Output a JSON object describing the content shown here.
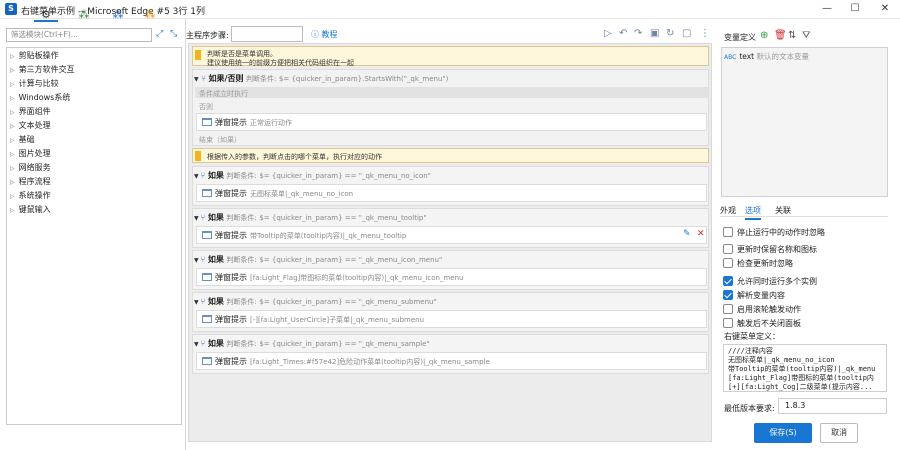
{
  "window": {
    "title": "右键菜单示例 -- Microsoft Edge #5 3行 1列",
    "minimize_icon": "minimize-icon",
    "maximize_icon": "maximize-icon",
    "close_icon": "close-icon"
  },
  "left": {
    "search_placeholder": "筛选模块(Ctrl+F)...",
    "tree": [
      "剪贴板操作",
      "第三方软件交互",
      "计算与比较",
      "Windows系统",
      "界面组件",
      "文本处理",
      "基础",
      "图片处理",
      "网络服务",
      "程序流程",
      "系统操作",
      "键鼠输入"
    ]
  },
  "middle": {
    "step_label": "主程序步骤:",
    "step_value": "",
    "tutorial": "教程",
    "notes": [
      {
        "line1": "判断是否是菜单调用。",
        "line2": "建议使用统一的前缀方便把相关代码组织在一起"
      },
      {
        "line1": "根据传入的参数，判断点击的哪个菜单，执行对应的动作"
      }
    ],
    "first_if": {
      "label": "如果/否则",
      "cond_prefix": "判断条件:",
      "cond": "$= {quicker_in_param}.StartsWith(\"_qk_menu\")",
      "then_label": "条件成立时执行",
      "else_label": "否则",
      "popup_label": "弹窗提示",
      "popup_arg": "正常运行动作",
      "end_label": "结束（如果）"
    },
    "ifs": [
      {
        "label": "如果",
        "cond_prefix": "判断条件:",
        "cond": "$= {quicker_in_param} == \"_qk_menu_no_icon\"",
        "popup_label": "弹窗提示",
        "popup_arg": "无图标菜单|_qk_menu_no_icon"
      },
      {
        "label": "如果",
        "cond_prefix": "判断条件:",
        "cond": "$= {quicker_in_param} == \"_qk_menu_tooltip\"",
        "popup_label": "弹窗提示",
        "popup_arg": "带Tooltip的菜单(tooltip内容)|_qk_menu_tooltip"
      },
      {
        "label": "如果",
        "cond_prefix": "判断条件:",
        "cond": "$= {quicker_in_param} == \"_qk_menu_icon_menu\"",
        "popup_label": "弹窗提示",
        "popup_arg": "[fa:Light_Flag]带图标的菜单(tooltip内容)|_qk_menu_icon_menu"
      },
      {
        "label": "如果",
        "cond_prefix": "判断条件:",
        "cond": "$= {quicker_in_param} == \"_qk_menu_submenu\"",
        "popup_label": "弹窗提示",
        "popup_arg": "[-][fa:Light_UserCircle]子菜单|_qk_menu_submenu"
      },
      {
        "label": "如果",
        "cond_prefix": "判断条件:",
        "cond": "$= {quicker_in_param} == \"_qk_menu_sample\"",
        "popup_label": "弹窗提示",
        "popup_arg": "[fa:Light_Times:#f57e42]危险动作菜单(tooltip内容)|_qk_menu_sample"
      }
    ]
  },
  "right": {
    "var_title": "变量定义",
    "var_name": "text",
    "var_desc": "默认的文本变量",
    "tabs": [
      "外观",
      "选项",
      "关联"
    ],
    "options": [
      {
        "label": "停止运行中的动作时忽略",
        "checked": false
      },
      {
        "label": "更新时保留名称和图标",
        "checked": false
      },
      {
        "label": "检查更新时忽略",
        "checked": false
      },
      {
        "label": "允许同时运行多个实例",
        "checked": true
      },
      {
        "label": "解析变量内容",
        "checked": true
      },
      {
        "label": "启用滚轮触发动作",
        "checked": false
      },
      {
        "label": "触发后不关闭面板",
        "checked": false
      }
    ],
    "rc_label": "右键菜单定义：",
    "rc_lines": [
      "////注释内容",
      "无图标菜单|_qk_menu_no_icon",
      "带Tooltip的菜单(tooltip内容)|_qk_menu",
      "[fa:Light_Flag]带图标的菜单(tooltip内",
      "[+][fa:Light_Cog]二级菜单(提示内容..."
    ],
    "minver_label": "最低版本要求:",
    "minver_value": "1.8.3",
    "save": "保存(S)",
    "cancel": "取消"
  },
  "colors": {
    "accent": "#1976d2",
    "note_bg": "#fdf6da",
    "canvas_bg": "#ececec"
  }
}
